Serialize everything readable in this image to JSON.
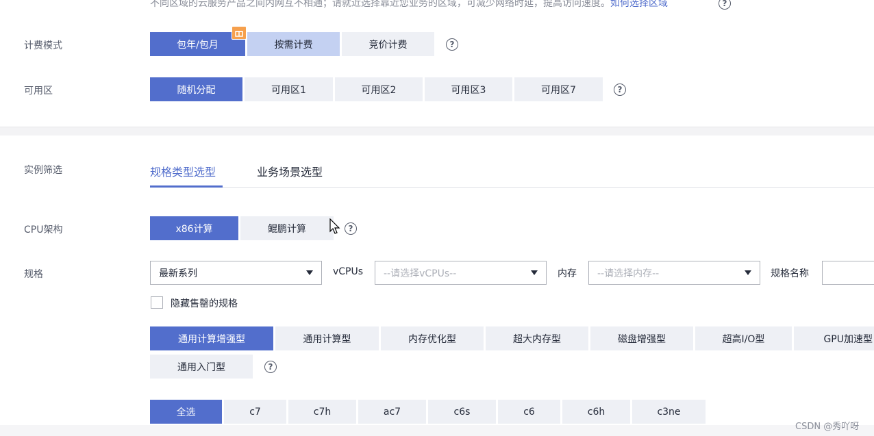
{
  "region_note": {
    "text": "不同区域的云服务产品之间内网互不相通；请就近选择靠近您业务的区域，可减少网络时延，提高访问速度。",
    "link": "如何选择区域"
  },
  "billing": {
    "label": "计费模式",
    "options": [
      "包年/包月",
      "按需计费",
      "竞价计费"
    ],
    "selected": "包年/包月"
  },
  "az": {
    "label": "可用区",
    "options": [
      "随机分配",
      "可用区1",
      "可用区2",
      "可用区3",
      "可用区7"
    ],
    "selected": "随机分配"
  },
  "filter": {
    "label": "实例筛选",
    "tabs": [
      "规格类型选型",
      "业务场景选型"
    ],
    "active_tab": "规格类型选型"
  },
  "cpu": {
    "label": "CPU架构",
    "options": [
      "x86计算",
      "鲲鹏计算"
    ],
    "selected": "x86计算"
  },
  "spec": {
    "label": "规格",
    "series_value": "最新系列",
    "vcpus_label": "vCPUs",
    "vcpus_placeholder": "--请选择vCPUs--",
    "memory_label": "内存",
    "memory_placeholder": "--请选择内存--",
    "name_label": "规格名称",
    "hide_soldout": "隐藏售罄的规格"
  },
  "spec_types": {
    "options": [
      "通用计算增强型",
      "通用计算型",
      "内存优化型",
      "超大内存型",
      "磁盘增强型",
      "超高I/O型",
      "GPU加速型",
      "通用入门型"
    ],
    "selected": "通用计算增强型"
  },
  "series_filter": {
    "options": [
      "全选",
      "c7",
      "c7h",
      "ac7",
      "c6s",
      "c6",
      "c6h",
      "c3ne"
    ],
    "selected": "全选"
  },
  "watermark": "CSDN @秀吖呀",
  "colors": {
    "primary": "#526ecc",
    "light_selected": "#c4d1f2",
    "segment_bg": "#eef0f5"
  }
}
